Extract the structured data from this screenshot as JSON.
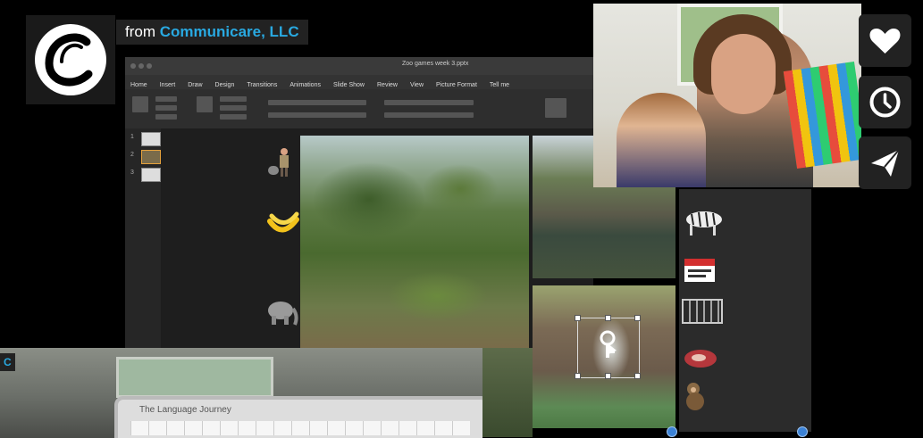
{
  "byline": {
    "from": "from",
    "owner": "Communicare, LLC"
  },
  "ppt": {
    "window_title": "Zoo games week 3.pptx",
    "tabs": [
      "Home",
      "Insert",
      "Draw",
      "Design",
      "Transitions",
      "Animations",
      "Slide Show",
      "Review",
      "View",
      "Picture Format",
      "Tell me"
    ]
  },
  "slide_thumbnails": [
    {
      "number": "1"
    },
    {
      "number": "2"
    },
    {
      "number": "3"
    }
  ],
  "video2": {
    "badge": "C",
    "screen_text": "The Language Journey"
  },
  "icons": {
    "logo": "channel-logo-c-icon",
    "like": "heart-icon",
    "watch_later": "clock-icon",
    "share": "paper-plane-icon"
  },
  "colors": {
    "accent": "#29a9e1",
    "button_bg": "#222222"
  }
}
